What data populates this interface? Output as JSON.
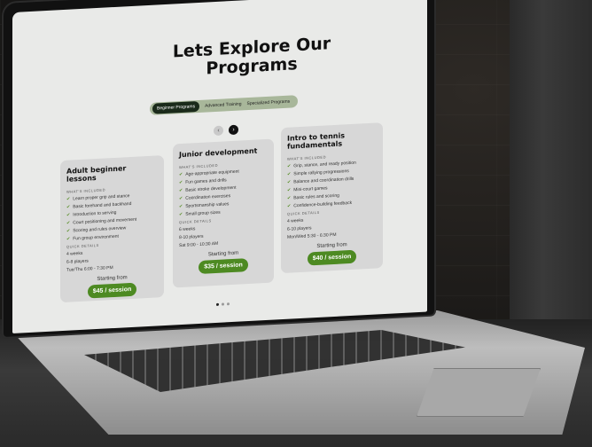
{
  "page": {
    "title": "Lets Explore Our Programs"
  },
  "tabs": [
    {
      "label": "Beginner Programs"
    },
    {
      "label": "Advanced Training"
    },
    {
      "label": "Specialized Programs"
    }
  ],
  "carousel": {
    "prev_icon": "‹",
    "next_icon": "›"
  },
  "cards": [
    {
      "title": "Adult beginner lessons",
      "included_label": "WHAT'S INCLUDED",
      "items": [
        "Learn proper grip and stance",
        "Basic forehand and backhand",
        "Introduction to serving",
        "Court positioning and movement",
        "Scoring and rules overview",
        "Fun group environment"
      ],
      "details_label": "QUICK DETAILS",
      "details": [
        "4 weeks",
        "6-8 players",
        "Tue/Thu 6:00 - 7:30 PM"
      ],
      "from": "Starting from",
      "price": "$45 / session"
    },
    {
      "title": "Junior development",
      "included_label": "WHAT'S INCLUDED",
      "items": [
        "Age-appropriate equipment",
        "Fun games and drills",
        "Basic stroke development",
        "Coordination exercises",
        "Sportsmanship values",
        "Small group sizes"
      ],
      "details_label": "QUICK DETAILS",
      "details": [
        "6 weeks",
        "8-10 players",
        "Sat 9:00 - 10:30 AM"
      ],
      "from": "Starting from",
      "price": "$35 / session"
    },
    {
      "title": "Intro to tennis fundamentals",
      "included_label": "WHAT'S INCLUDED",
      "items": [
        "Grip, stance, and ready position",
        "Simple rallying progressions",
        "Balance and coordination drills",
        "Mini-court games",
        "Basic rules and scoring",
        "Confidence-building feedback"
      ],
      "details_label": "QUICK DETAILS",
      "details": [
        "4 weeks",
        "6-10 players",
        "Mon/Wed 5:30 - 6:30 PM"
      ],
      "from": "Starting from",
      "price": "$40 / session"
    }
  ],
  "pagination": {
    "count": 3,
    "active_index": 0
  },
  "colors": {
    "accent": "#4d8a22",
    "tab_track": "#a8b79a",
    "tab_active": "#1a2a1a",
    "card_bg": "#d7d7d7",
    "screen_bg": "#e9eae8"
  }
}
